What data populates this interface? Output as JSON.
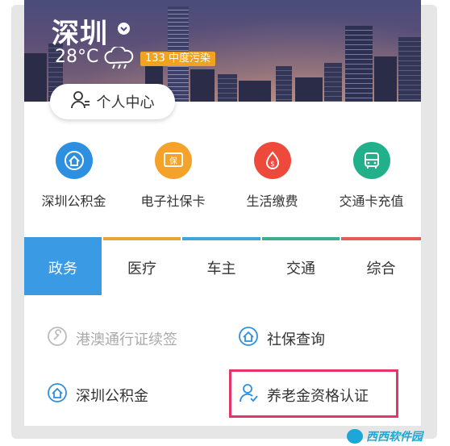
{
  "header": {
    "city": "深圳",
    "temperature": "28°C",
    "air_quality": "133 中度污染"
  },
  "personal_center": {
    "label": "个人中心"
  },
  "quick_actions": [
    {
      "label": "深圳公积金",
      "icon": "house-fund-icon",
      "color": "#2d8fe0"
    },
    {
      "label": "电子社保卡",
      "icon": "social-security-card-icon",
      "color": "#f5a22a"
    },
    {
      "label": "生活缴费",
      "icon": "payment-icon",
      "color": "#ee4a3c"
    },
    {
      "label": "交通卡充值",
      "icon": "bus-card-icon",
      "color": "#21b08a"
    }
  ],
  "tabs": [
    {
      "label": "政务",
      "active": true,
      "accent": "#3a9ae4"
    },
    {
      "label": "医疗",
      "active": false,
      "accent": "#e8a637"
    },
    {
      "label": "车主",
      "active": false,
      "accent": "#3ea7d9"
    },
    {
      "label": "交通",
      "active": false,
      "accent": "#3cae8c"
    },
    {
      "label": "综合",
      "active": false,
      "accent": "#e55b55"
    }
  ],
  "services": [
    {
      "label": "港澳通行证续签",
      "icon": "wrench-icon",
      "disabled": true
    },
    {
      "label": "社保查询",
      "icon": "house-shield-icon",
      "disabled": false
    },
    {
      "label": "深圳公积金",
      "icon": "house-fund-icon",
      "disabled": false
    },
    {
      "label": "养老金资格认证",
      "icon": "person-verify-icon",
      "disabled": false,
      "highlighted": true
    }
  ],
  "watermark": {
    "text": "西西软件园"
  },
  "colors": {
    "primary": "#3a9ae4",
    "highlight": "#e5366a",
    "aqi_badge": "#f0a320"
  }
}
